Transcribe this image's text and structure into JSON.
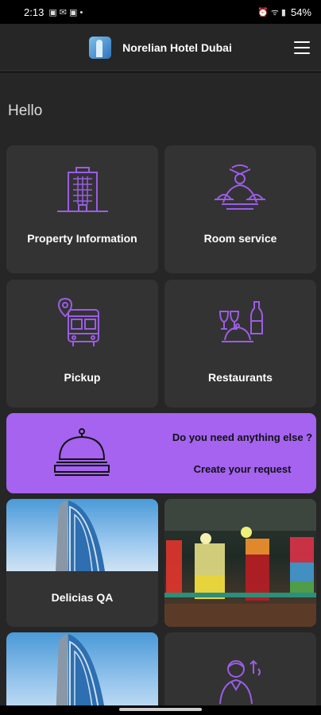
{
  "status": {
    "time": "2:13",
    "left_icons": "▣ ✉ ▣ •",
    "right_icons": "⏰ ᯤ ▮",
    "battery": "54%"
  },
  "header": {
    "title": "Norelian Hotel Dubai"
  },
  "greeting": "Hello",
  "tiles": [
    {
      "label": "Property Information"
    },
    {
      "label": "Room service"
    },
    {
      "label": "Pickup"
    },
    {
      "label": "Restaurants"
    }
  ],
  "promo": {
    "question": "Do you need anything else ?",
    "cta": "Create your request"
  },
  "photo_tiles": [
    {
      "label": "Delicias QA"
    }
  ],
  "colors": {
    "accent": "#a563f0",
    "icon": "#9b5de5",
    "card": "#333333",
    "background": "#262626"
  }
}
